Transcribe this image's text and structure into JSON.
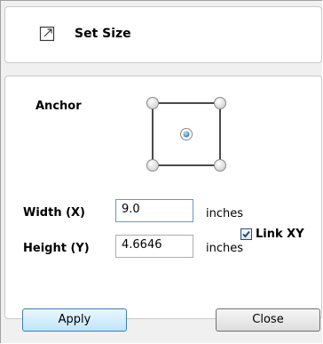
{
  "header": {
    "title": "Set Size",
    "icon": "resize-icon"
  },
  "anchor": {
    "label": "Anchor",
    "selected": "center"
  },
  "width": {
    "label": "Width (X)",
    "value": "9.0",
    "unit": "inches"
  },
  "height": {
    "label": "Height (Y)",
    "value": "4.6646",
    "unit": "inches"
  },
  "link": {
    "label": "Link XY",
    "checked": true
  },
  "buttons": {
    "apply": "Apply",
    "close": "Close"
  }
}
